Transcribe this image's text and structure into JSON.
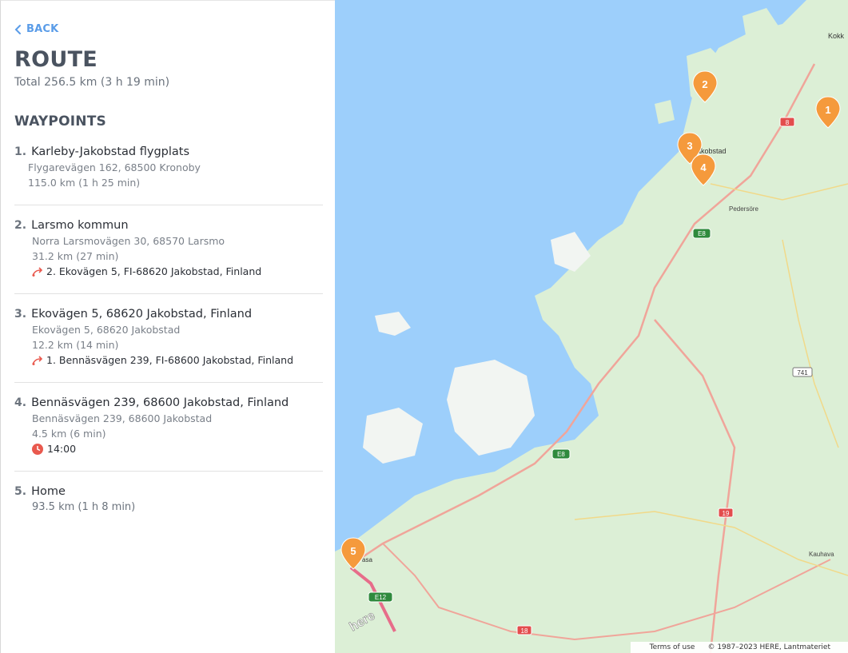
{
  "back_label": "BACK",
  "title": "ROUTE",
  "total": "Total 256.5 km (3 h 19 min)",
  "waypoints_heading": "WAYPOINTS",
  "waypoints": [
    {
      "num": "1.",
      "name": "Karleby-Jakobstad flygplats",
      "address": "Flygarevägen 162, 68500 Kronoby",
      "distance": "115.0 km (1 h 25 min)"
    },
    {
      "num": "2.",
      "name": "Larsmo kommun",
      "address": "Norra Larsmovägen 30, 68570 Larsmo",
      "distance": "31.2 km (27 min)",
      "link": "2. Ekovägen 5, FI-68620 Jakobstad, Finland"
    },
    {
      "num": "3.",
      "name": "Ekovägen 5, 68620 Jakobstad, Finland",
      "address": "Ekovägen 5, 68620 Jakobstad",
      "distance": "12.2 km (14 min)",
      "link": "1. Bennäsvägen 239, FI-68600 Jakobstad, Finland"
    },
    {
      "num": "4.",
      "name": "Bennäsvägen 239, 68600 Jakobstad, Finland",
      "address": "Bennäsvägen 239, 68600 Jakobstad",
      "distance": "4.5 km (6 min)",
      "time": "14:00"
    },
    {
      "num": "5.",
      "name": "Home",
      "distance": "93.5 km (1 h 8 min)"
    }
  ],
  "map": {
    "markers": [
      "1",
      "2",
      "3",
      "4",
      "5"
    ],
    "places": [
      "Kokk",
      "akobstad",
      "Pedersöre",
      "Kauhava",
      "asa"
    ],
    "road_shields": [
      "8",
      "E8",
      "E8",
      "741",
      "19",
      "E12",
      "18"
    ],
    "watermark": "here",
    "terms": "Terms of use",
    "copyright": "© 1987–2023 HERE, Lantmateriet"
  },
  "colors": {
    "accent": "#5a9ce8",
    "marker": "#f59a3c",
    "water": "#9dcffb",
    "land": "#dcefd6",
    "route_icon": "#e9594e"
  }
}
